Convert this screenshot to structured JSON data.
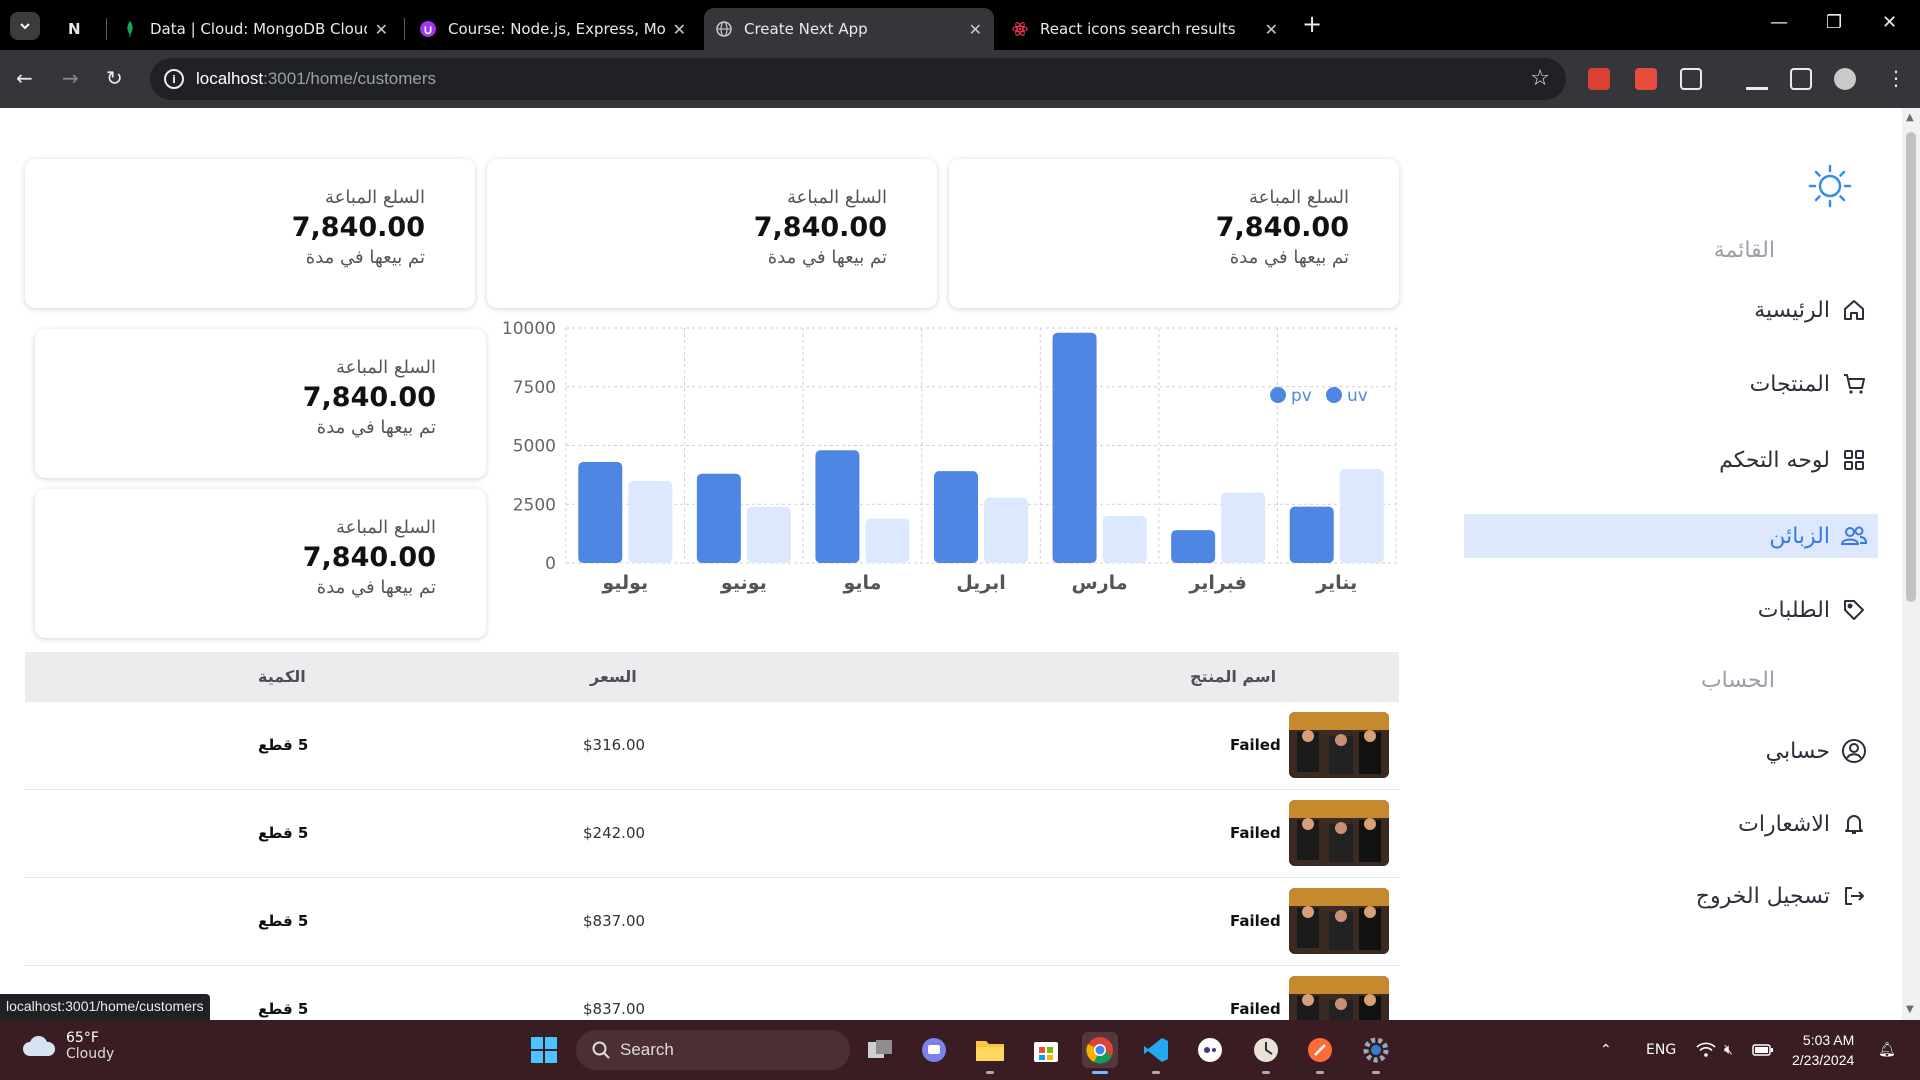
{
  "browser": {
    "tabs": [
      {
        "title": "N",
        "favicon": "notion-icon"
      },
      {
        "title": "Data | Cloud: MongoDB Cloud",
        "favicon": "mongodb-leaf-icon"
      },
      {
        "title": "Course: Node.js, Express, Mong",
        "favicon": "udemy-icon"
      },
      {
        "title": "Create Next App",
        "favicon": "globe-icon",
        "active": true
      },
      {
        "title": "React icons search results",
        "favicon": "react-icon"
      }
    ],
    "url_host": "localhost",
    "url_rest": ":3001/home/customers",
    "status_url": "localhost:3001/home/customers"
  },
  "sidebar": {
    "menu_heading": "القائمة",
    "account_heading": "الحساب",
    "items": [
      {
        "label": "الرئيسية",
        "icon": "home-icon"
      },
      {
        "label": "المنتجات",
        "icon": "cart-icon"
      },
      {
        "label": "لوحه التحكم",
        "icon": "dashboard-grid-icon"
      },
      {
        "label": "الزبائن",
        "icon": "users-icon",
        "active": true
      },
      {
        "label": "الطلبات",
        "icon": "tag-icon"
      }
    ],
    "account_items": [
      {
        "label": "حسابي",
        "icon": "user-circle-icon"
      },
      {
        "label": "الاشعارات",
        "icon": "bell-icon"
      },
      {
        "label": "تسجيل الخروج",
        "icon": "logout-icon"
      }
    ]
  },
  "cards": [
    {
      "label": "السلع المباعة",
      "value": "7,840.00",
      "sub": "تم بيعها في مدة"
    },
    {
      "label": "السلع المباعة",
      "value": "7,840.00",
      "sub": "تم بيعها في مدة"
    },
    {
      "label": "السلع المباعة",
      "value": "7,840.00",
      "sub": "تم بيعها في مدة"
    },
    {
      "label": "السلع المباعة",
      "value": "7,840.00",
      "sub": "تم بيعها في مدة"
    },
    {
      "label": "السلع المباعة",
      "value": "7,840.00",
      "sub": "تم بيعها في مدة"
    }
  ],
  "chart_data": {
    "type": "bar",
    "categories": [
      "يناير",
      "فبراير",
      "مارس",
      "ابريل",
      "مايو",
      "يونيو",
      "يوليو"
    ],
    "series": [
      {
        "name": "uv",
        "values": [
          4000,
          3000,
          2000,
          2780,
          1890,
          2390,
          3490
        ],
        "color": "#dbe8fd"
      },
      {
        "name": "pv",
        "values": [
          2400,
          1398,
          9800,
          3908,
          4800,
          3800,
          4300
        ],
        "color": "#4f86e3"
      }
    ],
    "legend_colors": {
      "pv": "#4f86e3",
      "uv": "#4f86e3"
    },
    "highlighted_series_note": "",
    "yticks": [
      0,
      2500,
      5000,
      7500,
      10000
    ],
    "ylim": [
      0,
      10000
    ],
    "xaxis": "reversed",
    "grid": true,
    "legend": "top-right"
  },
  "table": {
    "headers": {
      "name": "اسم المنتج",
      "price": "السعر",
      "qty": "الكمية"
    },
    "rows": [
      {
        "name": "Failed",
        "price": "$316.00",
        "qty": "5 قطع"
      },
      {
        "name": "Failed",
        "price": "$242.00",
        "qty": "5 قطع"
      },
      {
        "name": "Failed",
        "price": "$837.00",
        "qty": "5 قطع"
      },
      {
        "name": "Failed",
        "price": "$837.00",
        "qty": "5 قطع"
      }
    ]
  },
  "taskbar": {
    "weather_temp": "65°F",
    "weather_text": "Cloudy",
    "search_placeholder": "Search",
    "lang": "ENG",
    "time": "5:03 AM",
    "date": "2/23/2024"
  }
}
